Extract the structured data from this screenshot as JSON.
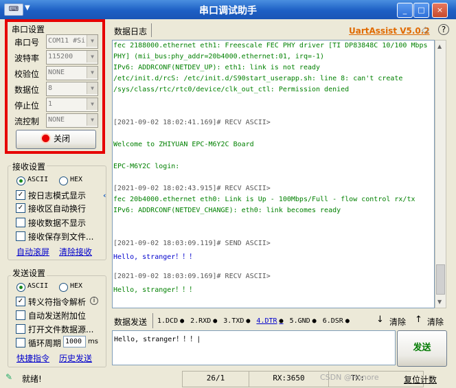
{
  "window": {
    "title": "串口调试助手",
    "sysicon_text": "⌨",
    "min": "_",
    "max": "□",
    "close": "×"
  },
  "serial": {
    "group_title": "串口设置",
    "fields": [
      {
        "label": "串口号",
        "value": "COM11 #Si"
      },
      {
        "label": "波特率",
        "value": "115200"
      },
      {
        "label": "校验位",
        "value": "NONE"
      },
      {
        "label": "数据位",
        "value": "8"
      },
      {
        "label": "停止位",
        "value": "1"
      },
      {
        "label": "流控制",
        "value": "NONE"
      }
    ],
    "close_button": "关闭"
  },
  "receive": {
    "group_title": "接收设置",
    "ascii": "ASCII",
    "hex": "HEX",
    "options": [
      "按日志模式显示",
      "接收区自动换行",
      "接收数据不显示",
      "接收保存到文件..."
    ],
    "checked": [
      true,
      true,
      false,
      false
    ],
    "auto_scroll": "自动滚屏",
    "clear_recv": "清除接收"
  },
  "send": {
    "group_title": "发送设置",
    "ascii": "ASCII",
    "hex": "HEX",
    "options": [
      "转义符指令解析",
      "自动发送附加位",
      "打开文件数据源...",
      "循环周期"
    ],
    "checked": [
      true,
      false,
      false,
      false
    ],
    "info_icon": "i",
    "period_value": "1000",
    "period_unit": "ms",
    "shortcut": "快捷指令",
    "history": "历史发送"
  },
  "log": {
    "tab": "数据日志",
    "brand": "UartAssist V5.0.2",
    "lines": [
      {
        "t": "fec 2188000.ethernet eth1: Freescale FEC PHY driver [TI DP83848C 10/100 Mbps",
        "c": "#008000"
      },
      {
        "t": "PHY] (mii_bus:phy_addr=20b4000.ethernet:01, irq=-1)",
        "c": "#008000"
      },
      {
        "t": "IPv6: ADDRCONF(NETDEV_UP): eth1: link is not ready",
        "c": "#008000"
      },
      {
        "t": "/etc/init.d/rcS: /etc/init.d/S90start_userapp.sh: line 8: can't create",
        "c": "#008000"
      },
      {
        "t": "/sys/class/rtc/rtc0/device/clk_out_ctl: Permission denied",
        "c": "#008000"
      },
      {
        "t": "",
        "c": "#008000"
      },
      {
        "t": "",
        "c": "#008000"
      },
      {
        "t": "[2021-09-02 18:02:41.169]# RECV ASCII>",
        "c": "#555555"
      },
      {
        "t": "",
        "c": "#008000"
      },
      {
        "t": "Welcome to ZHIYUAN EPC-M6Y2C Board",
        "c": "#008000"
      },
      {
        "t": "",
        "c": "#008000"
      },
      {
        "t": "EPC-M6Y2C login:",
        "c": "#008000"
      },
      {
        "t": "",
        "c": "#008000"
      },
      {
        "t": "[2021-09-02 18:02:43.915]# RECV ASCII>",
        "c": "#555555"
      },
      {
        "t": "fec 20b4000.ethernet eth0: Link is Up - 100Mbps/Full - flow control rx/tx",
        "c": "#008000"
      },
      {
        "t": "IPv6: ADDRCONF(NETDEV_CHANGE): eth0: link becomes ready",
        "c": "#008000"
      },
      {
        "t": "",
        "c": "#008000"
      },
      {
        "t": "",
        "c": "#008000"
      },
      {
        "t": "[2021-09-02 18:03:09.119]# SEND ASCII>",
        "c": "#555555"
      },
      {
        "t": "Hello, stranger！！！",
        "c": "#0000cc"
      },
      {
        "t": "",
        "c": "#008000"
      },
      {
        "t": "[2021-09-02 18:03:09.169]# RECV ASCII>",
        "c": "#555555"
      },
      {
        "t": "Hello, stranger！！！",
        "c": "#008000"
      }
    ]
  },
  "sendbar": {
    "tab": "数据发送",
    "signals": [
      {
        "label": "1.DCD",
        "dot": "●"
      },
      {
        "label": "2.RXD",
        "dot": "●"
      },
      {
        "label": "3.TXD",
        "dot": "●"
      },
      {
        "label": "4.DTR",
        "dot": "●"
      },
      {
        "label": "5.GND",
        "dot": "●"
      },
      {
        "label": "6.DSR",
        "dot": "●"
      }
    ],
    "clear1": "清除",
    "clear2": "清除",
    "input_text": "Hello, stranger！！！|",
    "send_button": "发送"
  },
  "status": {
    "text": "就绪!",
    "pages": "26/1",
    "rx": "RX:3650",
    "tx": "TX:",
    "watermark": "CSDN @Honore",
    "reset": "复位计数"
  },
  "colors": {
    "highlight": "#e60000",
    "brand": "#e06a00",
    "send_text": "#007a00"
  }
}
